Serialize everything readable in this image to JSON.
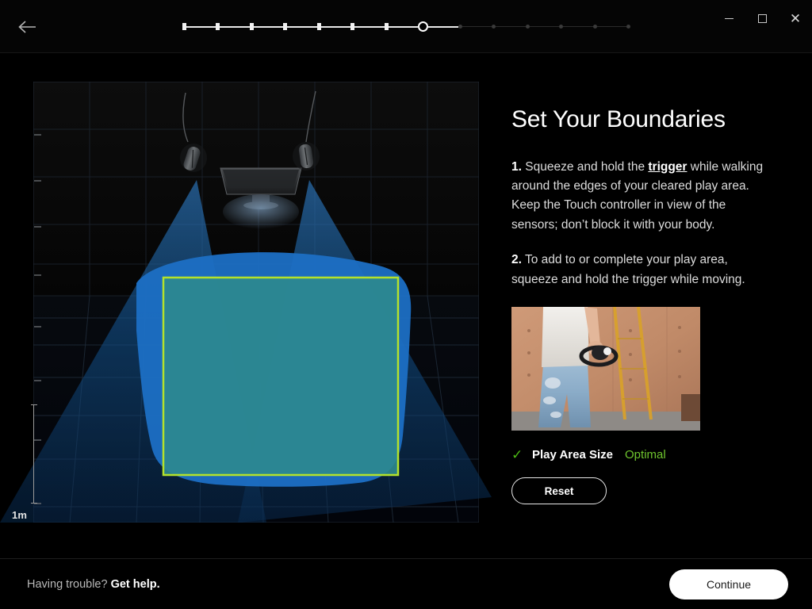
{
  "window": {
    "back_icon": "back-arrow-icon",
    "minimize_icon": "minimize-icon",
    "maximize_icon": "maximize-icon",
    "close_icon": "close-icon",
    "close_glyph": "✕"
  },
  "stepper": {
    "total_steps": 14,
    "current_step": 8,
    "completed_steps": 7,
    "remaining_steps": 6
  },
  "viewport": {
    "scale_label": "1m",
    "play_area_outline_color": "#b4e22b",
    "play_area_fill_color": "#2d8a8e",
    "traced_boundary_color": "#1c6fc4",
    "sensor_cone_color": "#123f74",
    "grid_line_color": "#1f2d3d",
    "sensor_count": 2,
    "monitor_present": true
  },
  "panel": {
    "heading": "Set Your Boundaries",
    "steps": [
      {
        "number": "1.",
        "text_before": " Squeeze and hold the ",
        "emphasis": "trigger",
        "text_after": " while walking around the edges of your cleared play area. Keep the Touch controller in view of the sensors; don’t block it with your body."
      },
      {
        "number": "2.",
        "text_before": " To add to or complete your play area, squeeze and hold the trigger while moving.",
        "emphasis": "",
        "text_after": ""
      }
    ],
    "photo_alt": "person-holding-touch-controller-photo",
    "status": {
      "check_icon": "check-icon",
      "check_glyph": "✓",
      "label": "Play Area Size",
      "value": "Optimal",
      "value_color": "#6fc52e"
    },
    "reset_label": "Reset"
  },
  "footer": {
    "help_prefix": "Having trouble? ",
    "help_link": "Get help.",
    "continue_label": "Continue"
  }
}
